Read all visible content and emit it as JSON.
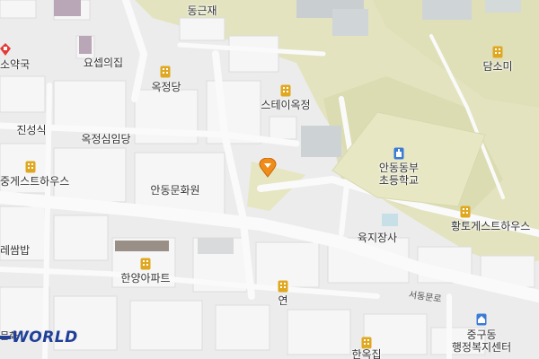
{
  "map": {
    "labels": {
      "dongeunjae": "동근재",
      "yakguk": "소약국",
      "yosep": "요셉의집",
      "okjeongdang": "옥정당",
      "stay": "스테이옥정",
      "damsomi": "담소미",
      "jinseongsik": "진성식",
      "okjeongsim": "옥정심임당",
      "guesthouse_jung": "중게스트하우스",
      "andong_culture": "안동문화원",
      "school": "안동동부\n초등학교",
      "hwangto": "황토게스트하우스",
      "yukji": "육지장사",
      "ssambap": "레쌈밥",
      "hanyang": "한양아파트",
      "yeon": "연",
      "jungu_office": "중구동\n행정복지센터",
      "hanok": "한옥집",
      "mun": "문화"
    },
    "road_name": "서동문로",
    "logo_text": "WORLD",
    "colors": {
      "background": "#ececec",
      "park": "#e6e6c2",
      "building": "#f7f7f7",
      "poi": "#e0a820",
      "marker": "#f08c1a",
      "school_icon": "#3a7bd5",
      "logo": "#1f3f99"
    },
    "icons": [
      "poi-building-icon",
      "location-pin-icon",
      "school-icon",
      "pharmacy-icon",
      "office-icon"
    ]
  }
}
